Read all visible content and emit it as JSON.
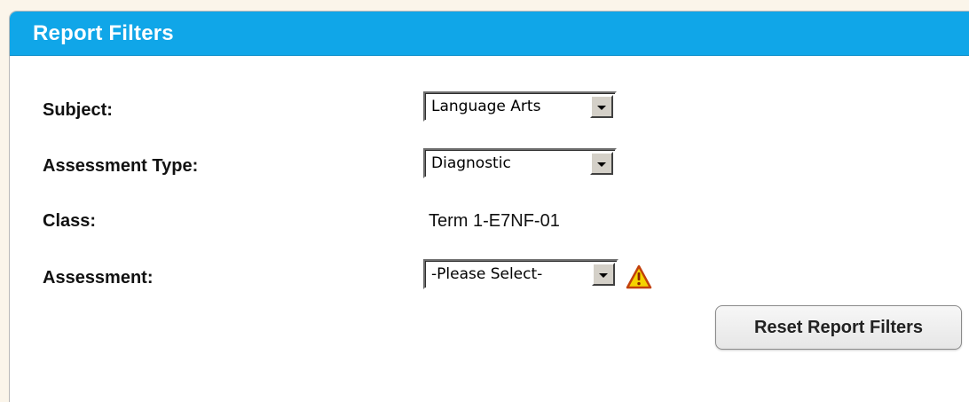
{
  "panel": {
    "title": "Report Filters"
  },
  "filters": {
    "subject": {
      "label": "Subject:",
      "selected": "Language Arts"
    },
    "assessment_type": {
      "label": "Assessment Type:",
      "selected": "Diagnostic"
    },
    "class": {
      "label": "Class:",
      "value": "Term 1-E7NF-01"
    },
    "assessment": {
      "label": "Assessment:",
      "selected": "-Please Select-",
      "warning_icon": "warning-triangle-icon"
    }
  },
  "actions": {
    "reset_label": "Reset Report Filters"
  },
  "colors": {
    "header_bg": "#10a6e8",
    "warning": "#f5d300"
  }
}
